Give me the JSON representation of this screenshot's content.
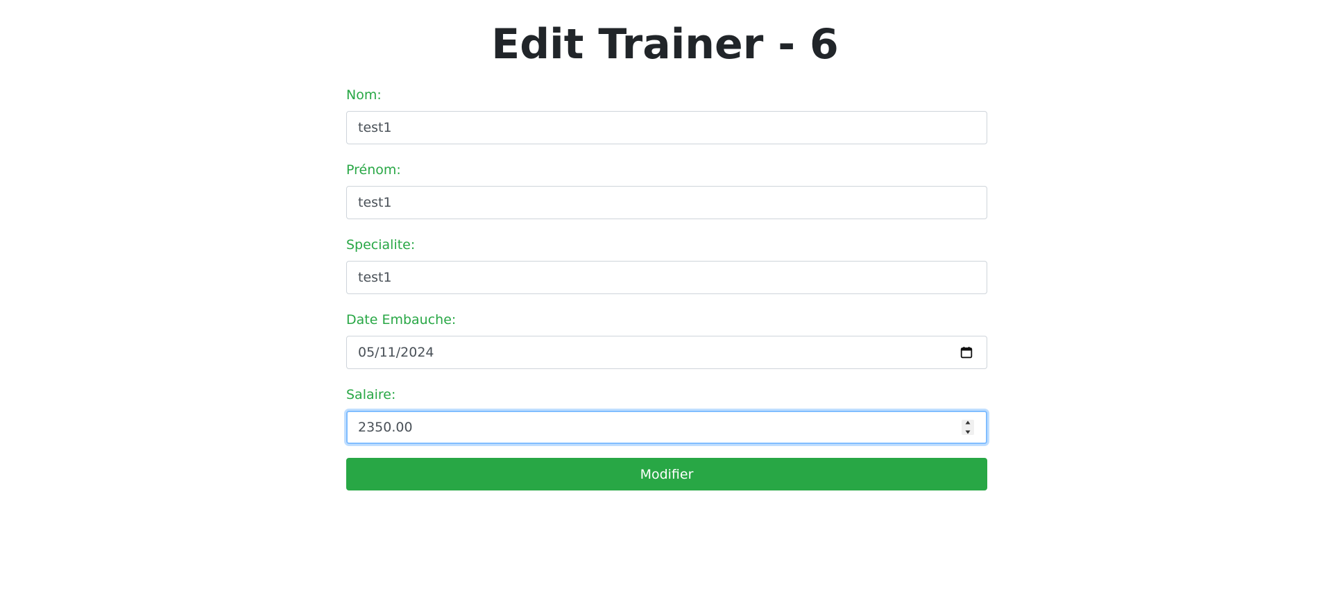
{
  "page": {
    "title": "Edit Trainer - 6"
  },
  "form": {
    "nom": {
      "label": "Nom:",
      "value": "test1"
    },
    "prenom": {
      "label": "Prénom:",
      "value": "test1"
    },
    "specialite": {
      "label": "Specialite:",
      "value": "test1"
    },
    "date_embauche": {
      "label": "Date Embauche:",
      "value": "05/11/2024"
    },
    "salaire": {
      "label": "Salaire:",
      "value": "2350.00"
    },
    "submit_label": "Modifier"
  },
  "colors": {
    "label": "#28a745",
    "button": "#28a745",
    "focus_border": "#80bdff",
    "title": "#212529"
  },
  "icons": {
    "date_picker": "calendar-icon",
    "number_spinner": "spinner-icon"
  }
}
